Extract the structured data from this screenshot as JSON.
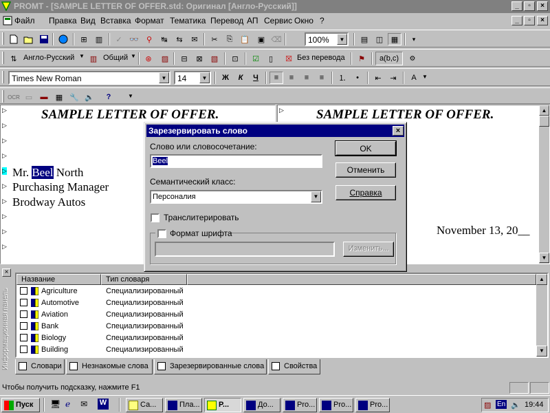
{
  "window": {
    "title": "PROMT - [SAMPLE LETTER OF OFFER.std: Оригинал [Англо-Русский]]"
  },
  "menu": [
    "Файл",
    "Правка",
    "Вид",
    "Вставка",
    "Формат",
    "Тематика",
    "Перевод",
    "АП",
    "Сервис",
    "Окно",
    "?"
  ],
  "toolbar": {
    "zoom": "100%",
    "direction": "Англо-Русский",
    "subject": "Общий",
    "no_translate": "Без перевода",
    "abc": "a(b,c)",
    "font_name": "Times New Roman",
    "font_size": "14",
    "bold": "Ж",
    "italic": "К",
    "underline": "Ч",
    "ocr": "OCR"
  },
  "left_pane": {
    "heading": "SAMPLE LETTER OF OFFER.",
    "line_prefix": "Mr. ",
    "selected_word": "Beel",
    "line_suffix": " North",
    "line2": "Purchasing Manager",
    "line3": "Brodway Autos"
  },
  "right_pane": {
    "heading": "SAMPLE LETTER OF OFFER.",
    "date": "November 13, 20__"
  },
  "dialog": {
    "title": "Зарезервировать слово",
    "word_label": "Слово или словосочетание:",
    "word_value": "Beel",
    "class_label": "Семантический класс:",
    "class_value": "Персоналия",
    "transliterate_label": "Транслитерировать",
    "font_format_label": "Формат шрифта",
    "change_button": "Изменить...",
    "ok_button": "OK",
    "cancel_button": "Отменить",
    "help_button": "Справка"
  },
  "info_panel": {
    "side_label": "Информационная панель",
    "columns": [
      "Название",
      "Тип словаря"
    ],
    "rows": [
      {
        "name": "Agriculture",
        "type": "Специализированный"
      },
      {
        "name": "Automotive",
        "type": "Специализированный"
      },
      {
        "name": "Aviation",
        "type": "Специализированный"
      },
      {
        "name": "Bank",
        "type": "Специализированный"
      },
      {
        "name": "Biology",
        "type": "Специализированный"
      },
      {
        "name": "Building",
        "type": "Специализированный"
      }
    ],
    "tabs": [
      "Словари",
      "Незнакомые слова",
      "Зарезервированные слова",
      "Свойства"
    ]
  },
  "status": {
    "hint": "Чтобы получить подсказку, нажмите F1"
  },
  "taskbar": {
    "start": "Пуск",
    "items": [
      "Са...",
      "Пла...",
      "P...",
      "До...",
      "Pro...",
      "Pro...",
      "Pro..."
    ],
    "lang": "En",
    "clock": "19:44"
  },
  "colors": {
    "face": "#c0c0c0",
    "title_active": "#000080",
    "selection": "#000080",
    "marker_highlight": "#00ffff"
  }
}
